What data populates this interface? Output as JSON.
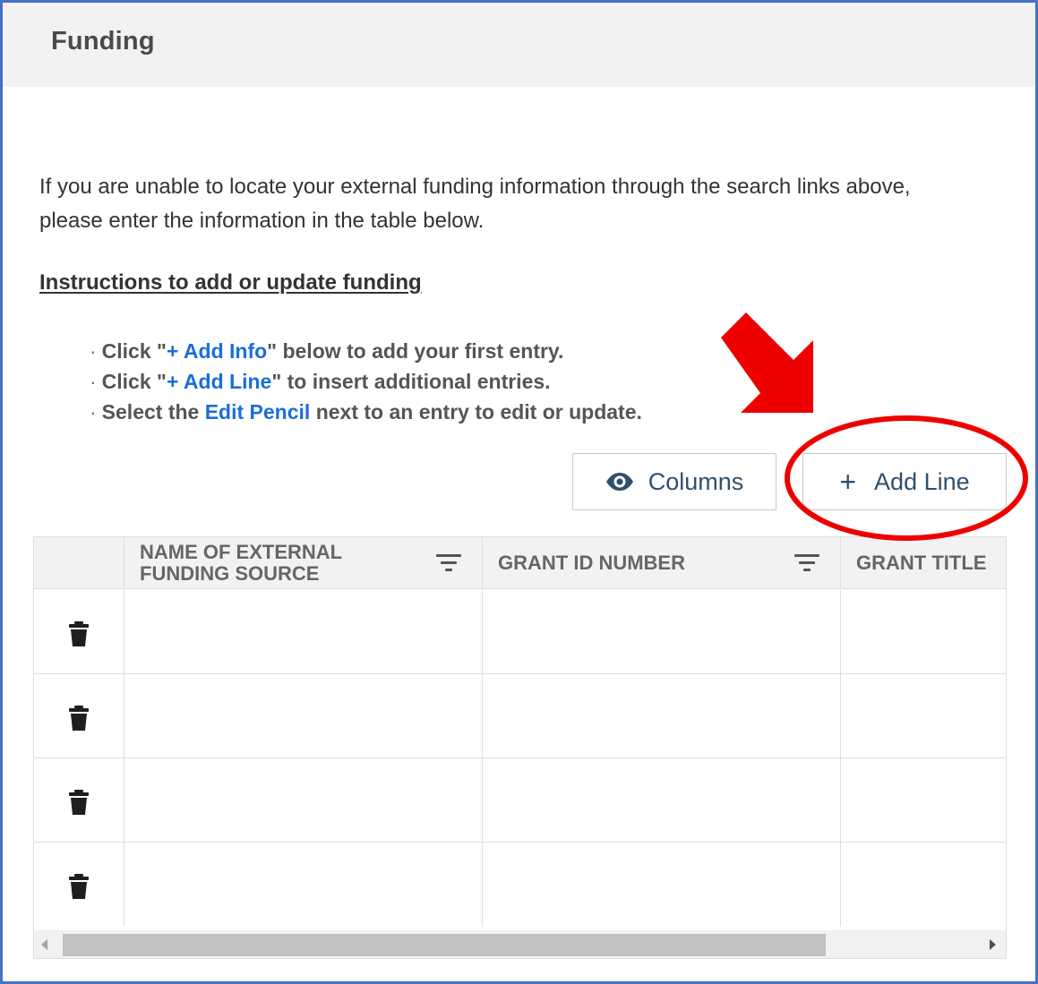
{
  "header": {
    "title": "Funding"
  },
  "intro": "If you are unable to locate your external funding information through the search links above, please enter the information in the table below.",
  "instructions": {
    "heading": "Instructions to add or update funding",
    "bullets": [
      {
        "before": "Click \"",
        "highlight": "+ Add Info",
        "after": "\" below to add your first entry."
      },
      {
        "before": "Click \"",
        "highlight": "+ Add Line",
        "after": "\" to insert additional entries."
      },
      {
        "before": "Select the ",
        "highlight": "Edit Pencil",
        "after": " next to an entry to edit or update."
      }
    ]
  },
  "toolbar": {
    "columns_label": "Columns",
    "columns_icon": "eye-icon",
    "add_line_label": "Add Line",
    "add_line_icon": "plus-icon"
  },
  "table": {
    "columns": [
      {
        "label": "NAME OF EXTERNAL FUNDING SOURCE",
        "filter": true
      },
      {
        "label": "GRANT ID NUMBER",
        "filter": true
      },
      {
        "label": "GRANT TITLE",
        "filter": false
      }
    ],
    "rows": [
      {
        "cells": [
          "",
          "",
          ""
        ],
        "action_icon": "trash-icon"
      },
      {
        "cells": [
          "",
          "",
          ""
        ],
        "action_icon": "trash-icon"
      },
      {
        "cells": [
          "",
          "",
          ""
        ],
        "action_icon": "trash-icon"
      },
      {
        "cells": [
          "",
          "",
          ""
        ],
        "action_icon": "trash-icon"
      }
    ]
  },
  "colors": {
    "frame_border": "#4472c4",
    "link_blue": "#1a6ed8",
    "annotation_red": "#ee0000",
    "header_bg": "#f2f2f2"
  }
}
